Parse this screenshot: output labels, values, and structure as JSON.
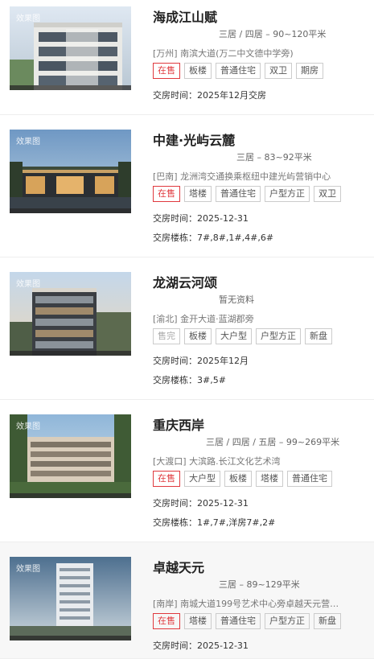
{
  "watermark": "效果图",
  "items": [
    {
      "name": "海成江山赋",
      "meta": "三居 / 四居 – 90~120平米",
      "address": "[万州] 南滨大道(万二中文德中学旁)",
      "tags": [
        "在售",
        "板楼",
        "普通住宅",
        "双卫",
        "期房"
      ],
      "lines": [
        "交房时间：2025年12月交房"
      ]
    },
    {
      "name": "中建·光屿云麓",
      "meta": "三居 – 83~92平米",
      "address": "[巴南] 龙洲湾交通换乘枢纽中建光屿营销中心",
      "tags": [
        "在售",
        "塔楼",
        "普通住宅",
        "户型方正",
        "双卫"
      ],
      "lines": [
        "交房时间：2025-12-31",
        "交房楼栋：7#,8#,1#,4#,6#"
      ]
    },
    {
      "name": "龙湖云河颂",
      "meta": "暂无资料",
      "address": "[渝北] 金开大道·蓝湖郡旁",
      "tags": [
        "售完",
        "板楼",
        "大户型",
        "户型方正",
        "新盘"
      ],
      "lines": [
        "交房时间：2025年12月",
        "交房楼栋：3#,5#"
      ]
    },
    {
      "name": "重庆西岸",
      "meta": "三居 / 四居 / 五居 – 99~269平米",
      "address": "[大渡口] 大滨路.长江文化艺术湾",
      "tags": [
        "在售",
        "大户型",
        "板楼",
        "塔楼",
        "普通住宅"
      ],
      "lines": [
        "交房时间：2025-12-31",
        "交房楼栋：1#,7#,洋房7#,2#"
      ]
    },
    {
      "name": "卓越天元",
      "meta": "三居 – 89~129平米",
      "address": "[南岸] 南城大道199号艺术中心旁卓越天元营销...",
      "tags": [
        "在售",
        "塔楼",
        "普通住宅",
        "户型方正",
        "新盘"
      ],
      "lines": [
        "交房时间：2025-12-31"
      ]
    }
  ]
}
